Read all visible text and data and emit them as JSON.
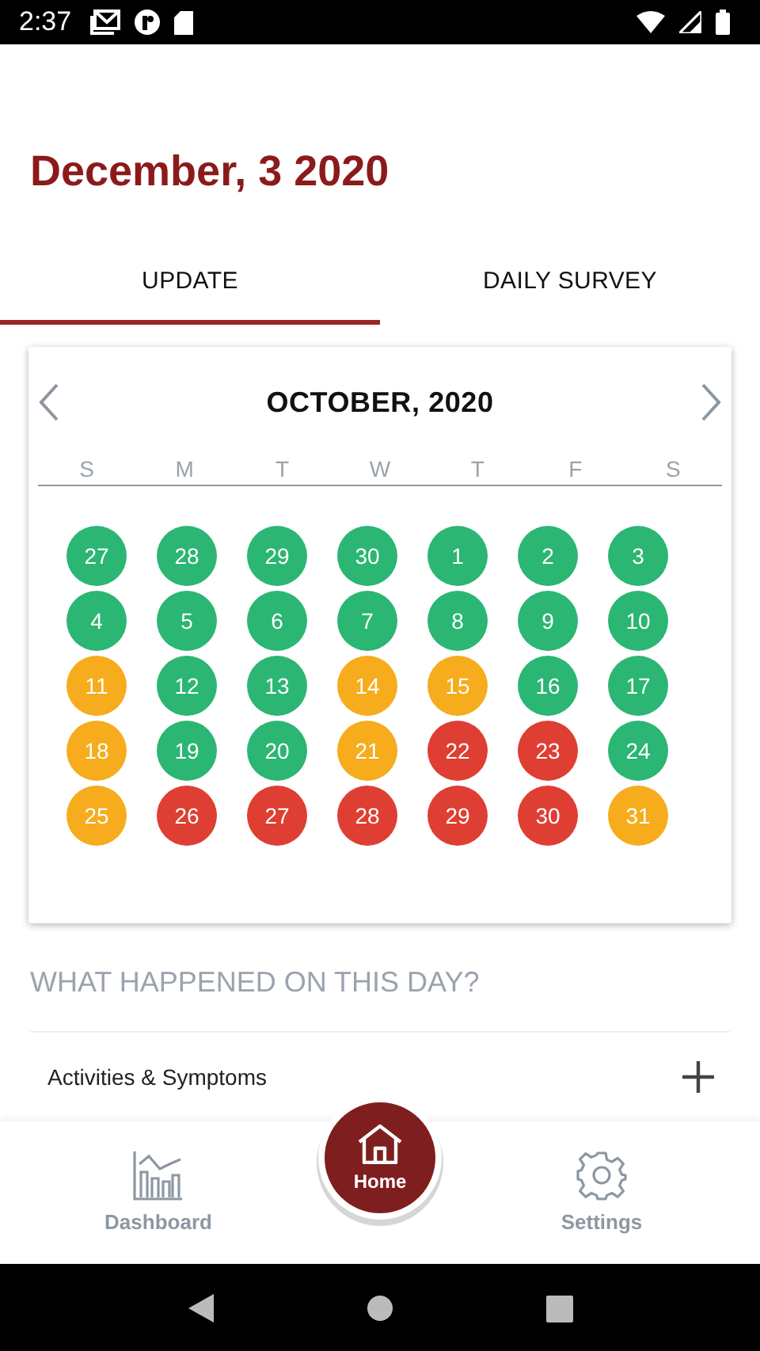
{
  "status_bar": {
    "time": "2:37"
  },
  "header": {
    "date": "December, 3 2020"
  },
  "tabs": [
    {
      "label": "UPDATE",
      "selected": true
    },
    {
      "label": "DAILY SURVEY",
      "selected": false
    }
  ],
  "calendar": {
    "month": "OCTOBER, 2020",
    "weekdays": [
      "S",
      "M",
      "T",
      "W",
      "T",
      "F",
      "S"
    ],
    "days": [
      {
        "label": "27",
        "color": "#2bb673"
      },
      {
        "label": "28",
        "color": "#2bb673"
      },
      {
        "label": "29",
        "color": "#2bb673"
      },
      {
        "label": "30",
        "color": "#2bb673"
      },
      {
        "label": "1",
        "color": "#2bb673"
      },
      {
        "label": "2",
        "color": "#2bb673"
      },
      {
        "label": "3",
        "color": "#2bb673"
      },
      {
        "label": "4",
        "color": "#2bb673"
      },
      {
        "label": "5",
        "color": "#2bb673"
      },
      {
        "label": "6",
        "color": "#2bb673"
      },
      {
        "label": "7",
        "color": "#2bb673"
      },
      {
        "label": "8",
        "color": "#2bb673"
      },
      {
        "label": "9",
        "color": "#2bb673"
      },
      {
        "label": "10",
        "color": "#2bb673"
      },
      {
        "label": "11",
        "color": "#f6ac1c"
      },
      {
        "label": "12",
        "color": "#2bb673"
      },
      {
        "label": "13",
        "color": "#2bb673"
      },
      {
        "label": "14",
        "color": "#f6ac1c"
      },
      {
        "label": "15",
        "color": "#f6ac1c"
      },
      {
        "label": "16",
        "color": "#2bb673"
      },
      {
        "label": "17",
        "color": "#2bb673"
      },
      {
        "label": "18",
        "color": "#f6ac1c"
      },
      {
        "label": "19",
        "color": "#2bb673"
      },
      {
        "label": "20",
        "color": "#2bb673"
      },
      {
        "label": "21",
        "color": "#f6ac1c"
      },
      {
        "label": "22",
        "color": "#df3e33"
      },
      {
        "label": "23",
        "color": "#df3e33"
      },
      {
        "label": "24",
        "color": "#2bb673"
      },
      {
        "label": "25",
        "color": "#f6ac1c"
      },
      {
        "label": "26",
        "color": "#df3e33"
      },
      {
        "label": "27",
        "color": "#df3e33"
      },
      {
        "label": "28",
        "color": "#df3e33"
      },
      {
        "label": "29",
        "color": "#df3e33"
      },
      {
        "label": "30",
        "color": "#df3e33"
      },
      {
        "label": "31",
        "color": "#f6ac1c"
      }
    ]
  },
  "section": {
    "title": "WHAT HAPPENED ON THIS DAY?",
    "items": [
      {
        "label": "Activities & Symptoms"
      }
    ]
  },
  "bottom_nav": [
    {
      "label": "Dashboard",
      "kind": "dashboard",
      "selected": false
    },
    {
      "label": "Home",
      "kind": "home",
      "selected": true
    },
    {
      "label": "Settings",
      "kind": "settings",
      "selected": false
    }
  ]
}
